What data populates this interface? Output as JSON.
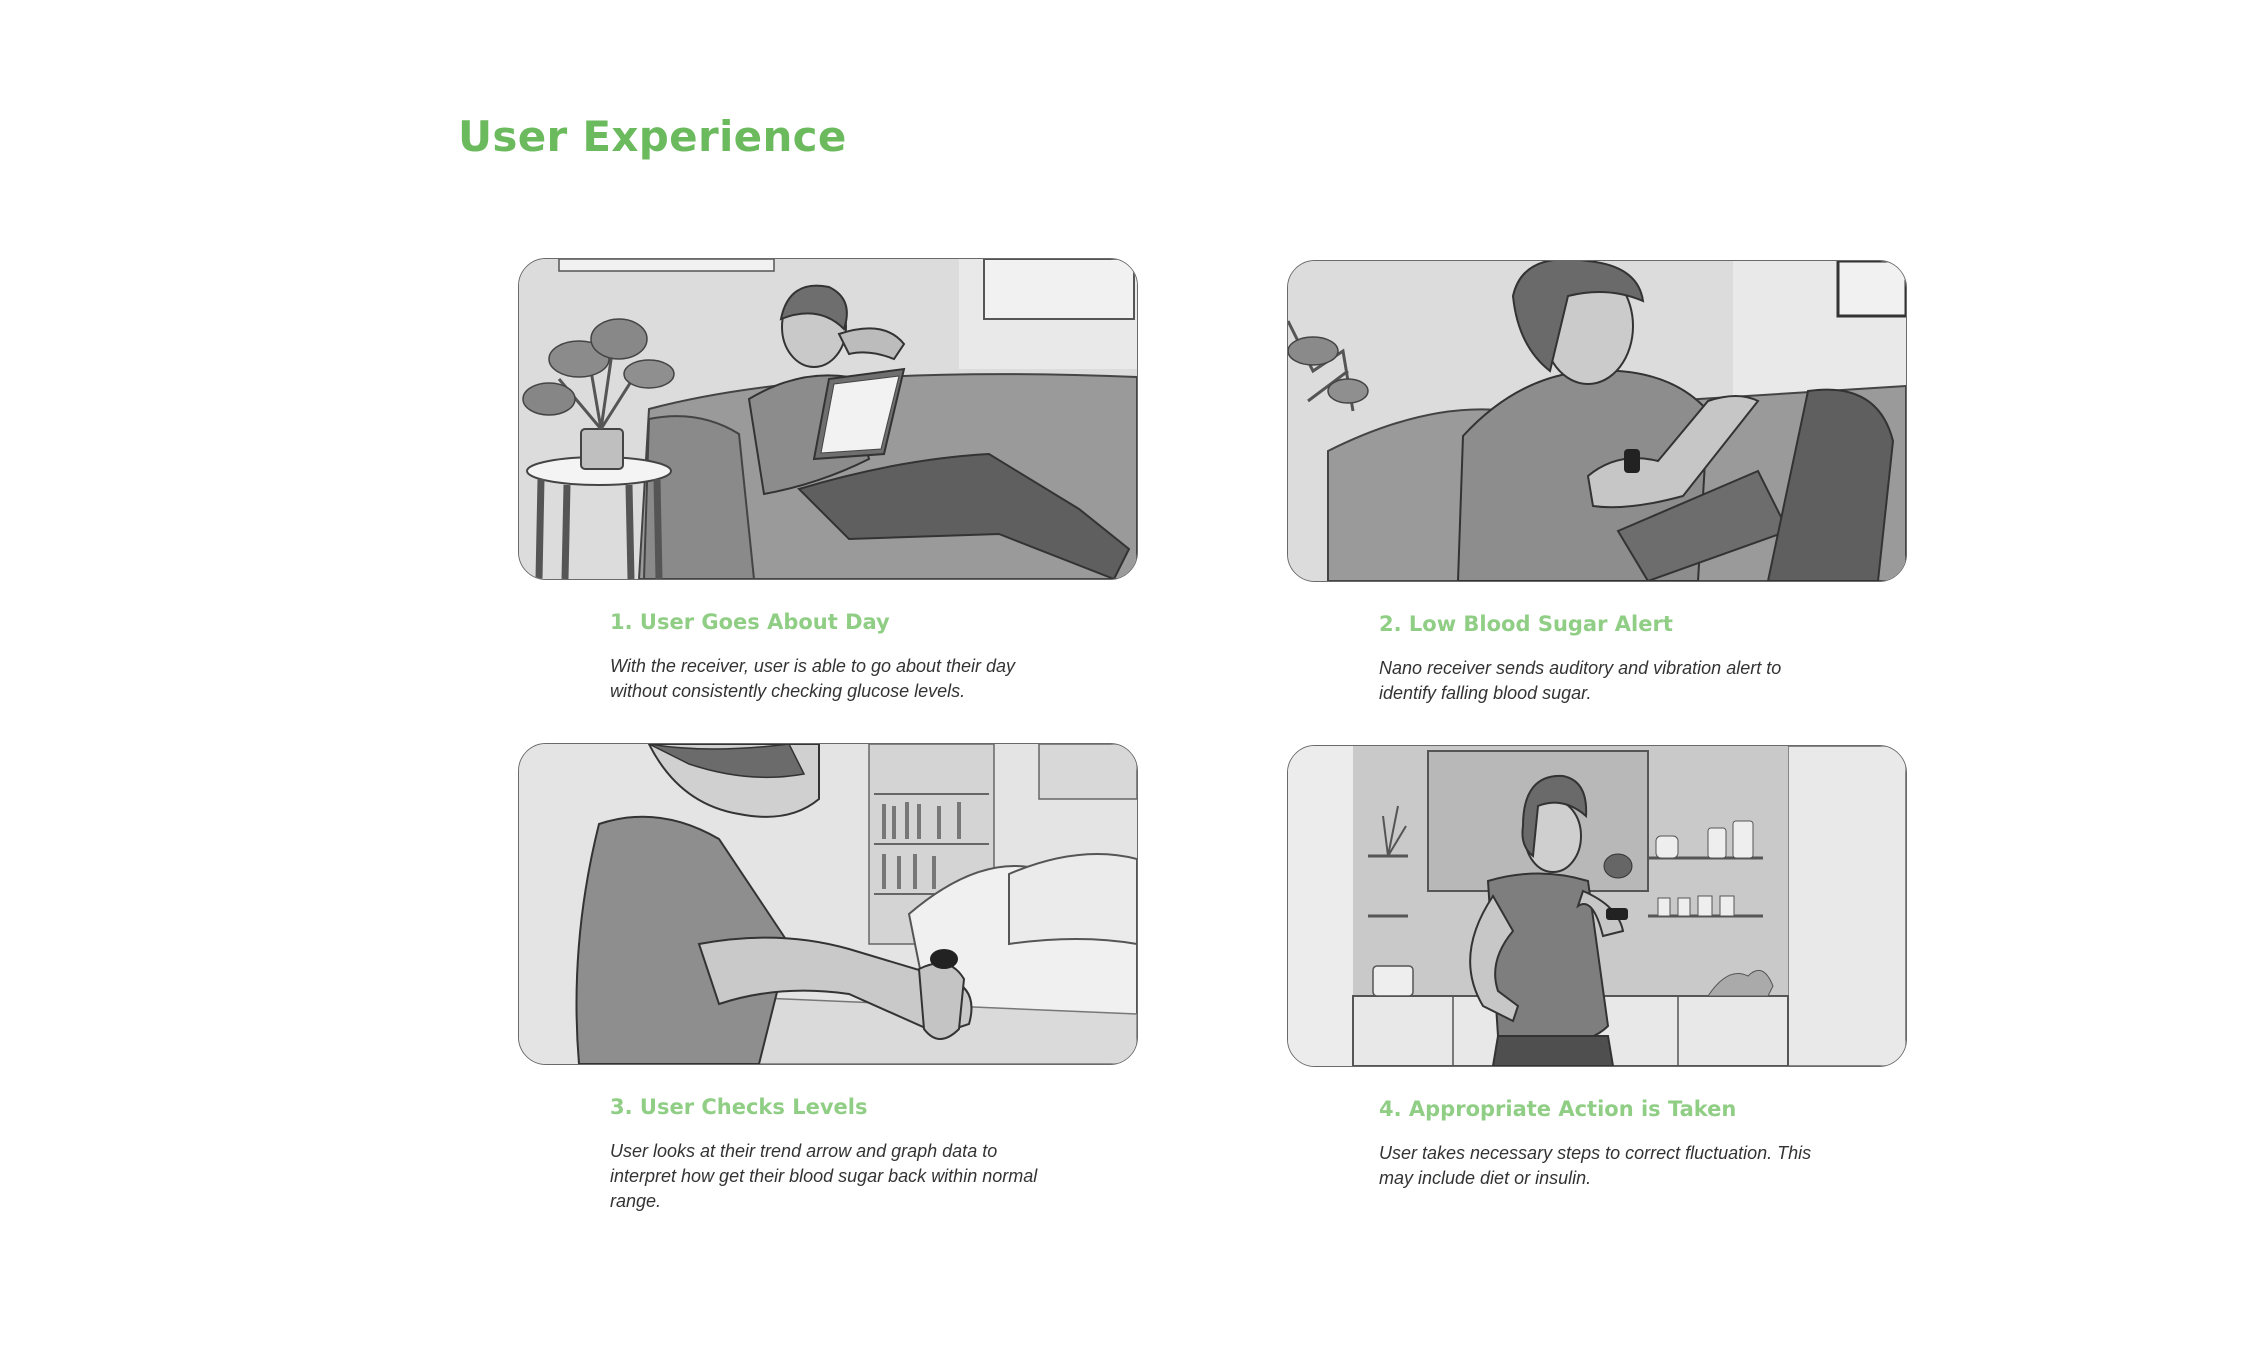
{
  "page": {
    "title": "User Experience",
    "accent_color": "#6cba5e",
    "step_title_color": "#8fce84"
  },
  "steps": [
    {
      "title": "1. User Goes About Day",
      "description": "With the receiver, user is able to go about their day without consistently checking glucose levels.",
      "illustration": "person-reading-on-couch-illustration"
    },
    {
      "title": "2. Low Blood Sugar Alert",
      "description": "Nano receiver sends auditory and vibration alert to identify falling blood sugar.",
      "illustration": "person-receiving-wrist-alert-illustration"
    },
    {
      "title": "3. User Checks Levels",
      "description": "User looks at their trend arrow and graph data to interpret how get their blood sugar back within normal range.",
      "illustration": "person-checking-wrist-device-illustration"
    },
    {
      "title": "4. Appropriate Action is Taken",
      "description": "User takes necessary steps to correct fluctuation. This may include diet or insulin.",
      "illustration": "person-eating-in-kitchen-illustration"
    }
  ]
}
